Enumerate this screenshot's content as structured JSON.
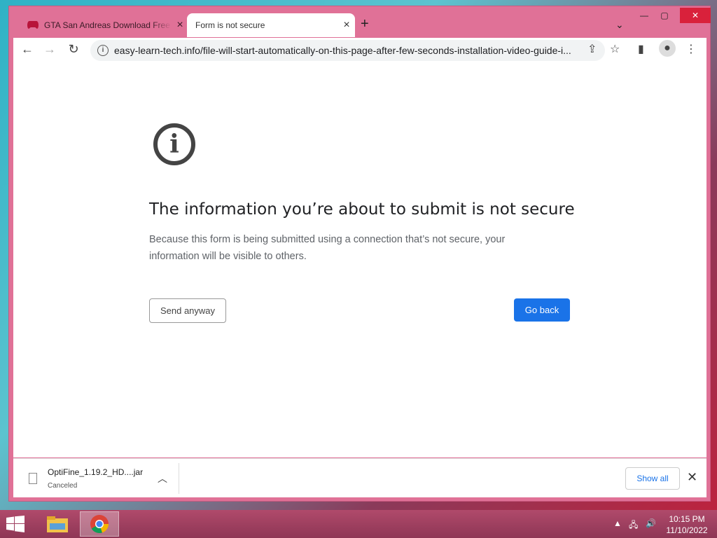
{
  "tabs": [
    {
      "label": "GTA San Andreas Download Free",
      "icon": "gamepad-icon"
    },
    {
      "label": "Form is not secure"
    }
  ],
  "address": "easy-learn-tech.info/file-will-start-automatically-on-this-page-after-few-seconds-installation-video-guide-i...",
  "page": {
    "title": "The information you’re about to submit is not secure",
    "body": "Because this form is being submitted using a connection that’s not secure, your information will be visible to others.",
    "send": "Send anyway",
    "back": "Go back"
  },
  "download": {
    "name": "OptiFine_1.19.2_HD....jar",
    "status": "Canceled",
    "show_all": "Show all"
  },
  "clock": {
    "time": "10:15 PM",
    "date": "11/10/2022"
  },
  "colors": {
    "frame": "#e07197",
    "accent": "#1a73e8",
    "close": "#d9213b"
  }
}
